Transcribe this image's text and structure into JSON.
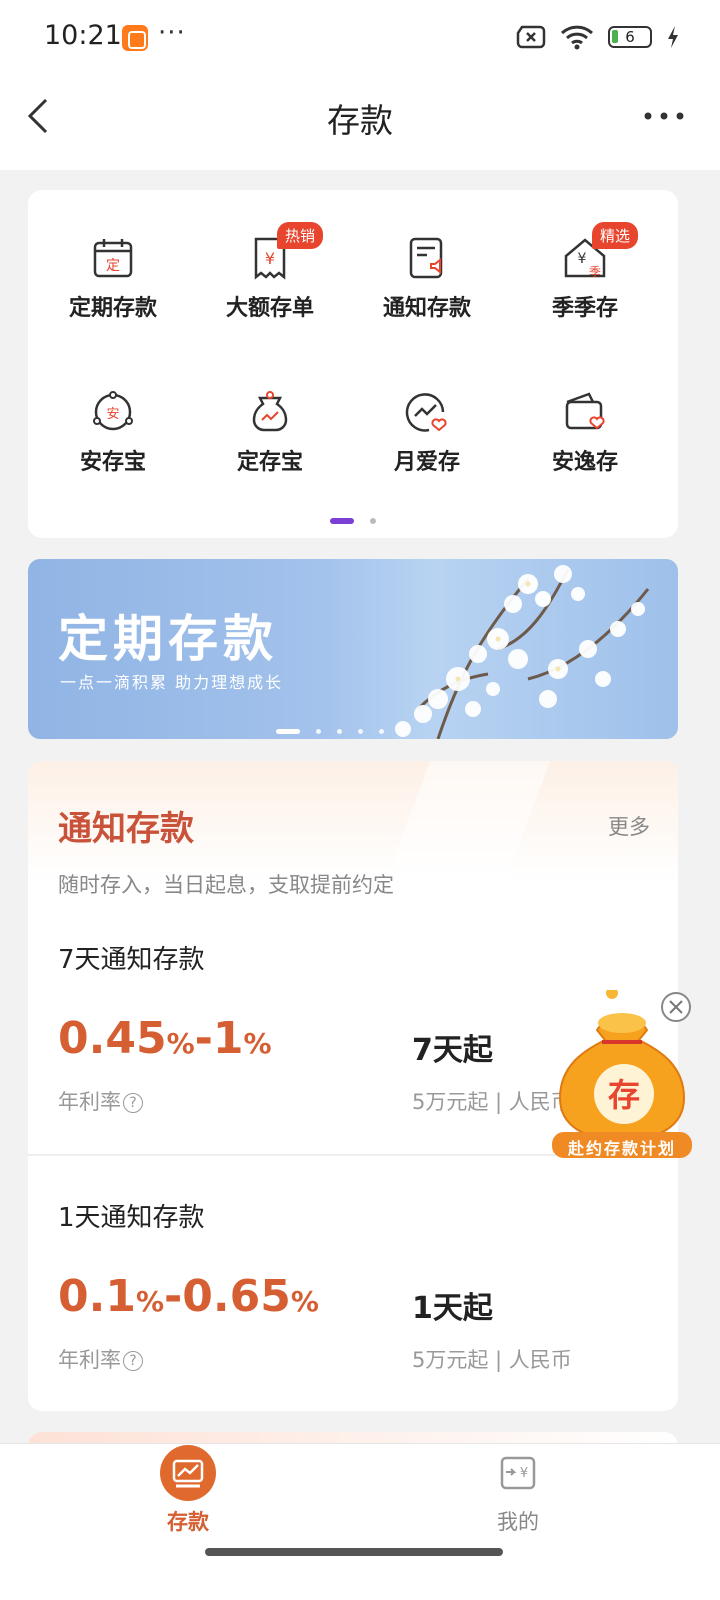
{
  "status": {
    "time": "10:21",
    "dots": "···",
    "battery": "6"
  },
  "nav": {
    "title": "存款"
  },
  "products_grid": {
    "items": [
      {
        "label": "定期存款",
        "icon": "calendar-deposit-icon"
      },
      {
        "label": "大额存单",
        "icon": "receipt-yuan-icon",
        "tag": "热销"
      },
      {
        "label": "通知存款",
        "icon": "notice-doc-icon"
      },
      {
        "label": "季季存",
        "icon": "season-house-icon",
        "tag": "精选"
      },
      {
        "label": "安存宝",
        "icon": "safe-circle-icon"
      },
      {
        "label": "定存宝",
        "icon": "money-bag-icon"
      },
      {
        "label": "月爱存",
        "icon": "trend-heart-icon"
      },
      {
        "label": "安逸存",
        "icon": "wallet-heart-icon"
      }
    ]
  },
  "banner": {
    "title": "定期存款",
    "subtitle": "一点一滴积累 助力理想成长"
  },
  "notice_section": {
    "title": "通知存款",
    "more": "更多",
    "desc": "随时存入，当日起息，支取提前约定",
    "products": [
      {
        "name": "7天通知存款",
        "rate_low": "0.45",
        "rate_high": "1",
        "rate_label": "年利率",
        "term": "7天起",
        "note": "5万元起 | 人民币"
      },
      {
        "name": "1天通知存款",
        "rate_low": "0.1",
        "rate_high": "0.65",
        "rate_label": "年利率",
        "term": "1天起",
        "note": "5万元起 | 人民币"
      }
    ]
  },
  "promo": {
    "bag_char": "存",
    "ribbon": "赴约存款计划"
  },
  "tabbar": {
    "tabs": [
      {
        "label": "存款",
        "active": true
      },
      {
        "label": "我的",
        "active": false
      }
    ]
  },
  "colors": {
    "accent": "#d55e32",
    "tag": "#e8452f",
    "title_red": "#c9523a",
    "pager": "#7b3fd6"
  }
}
